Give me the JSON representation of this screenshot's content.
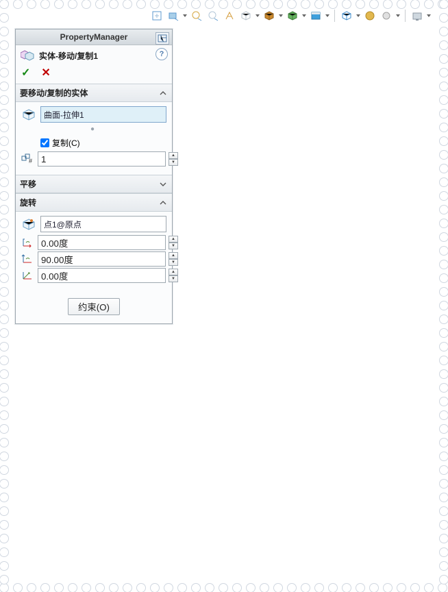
{
  "pm": {
    "title": "PropertyManager",
    "feature_name": "实体-移动/复制1",
    "help": "?"
  },
  "sections": {
    "bodies": {
      "header": "要移动/复制的实体",
      "selected": "曲面-拉伸1",
      "copy_label": "复制(C)",
      "copy_checked": true,
      "count": "1"
    },
    "translate": {
      "header": "平移"
    },
    "rotate": {
      "header": "旋转",
      "ref": "点1@原点",
      "angle_x": "0.00度",
      "angle_y": "90.00度",
      "angle_z": "0.00度"
    }
  },
  "buttons": {
    "constraints": "约束(O)"
  },
  "toolbar_icons": [
    "zoom-fit-icon",
    "zoom-area-icon",
    "key-icon",
    "zoom-icon",
    "rotate-view-icon",
    "pan-icon",
    "orient-icon",
    "display-style-icon",
    "section-icon",
    "filter-icon",
    "",
    "appearance-icon",
    "scene-icon"
  ]
}
